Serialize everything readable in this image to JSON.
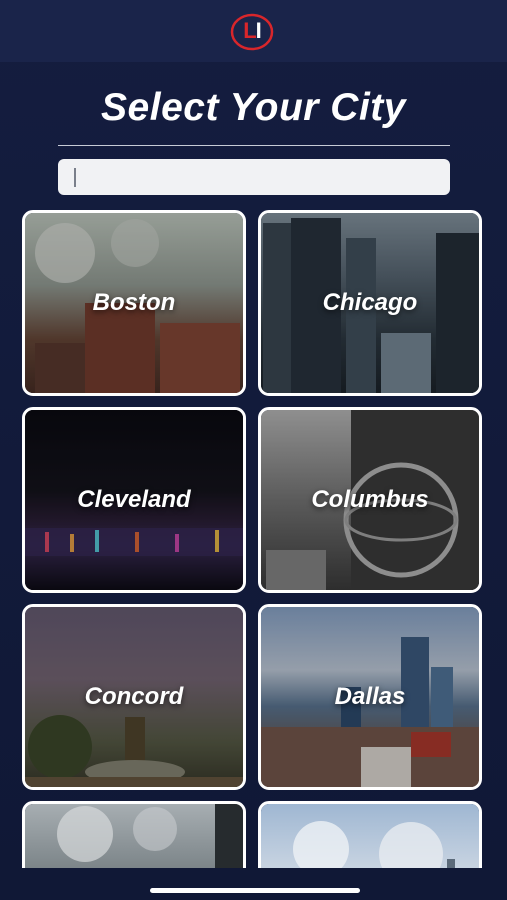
{
  "header": {
    "logo_text_l": "L",
    "logo_text_i": "I"
  },
  "page": {
    "title": "Select Your City"
  },
  "search": {
    "placeholder": "",
    "value": ""
  },
  "cities": [
    {
      "name": "Boston"
    },
    {
      "name": "Chicago"
    },
    {
      "name": "Cleveland"
    },
    {
      "name": "Columbus"
    },
    {
      "name": "Concord"
    },
    {
      "name": "Dallas"
    }
  ],
  "colors": {
    "header_bg": "#1a244a",
    "page_bg": "#141d3f",
    "logo_red": "#d9262b",
    "card_border": "#ffffff"
  },
  "icons": {
    "logo": "li-logo-icon"
  }
}
